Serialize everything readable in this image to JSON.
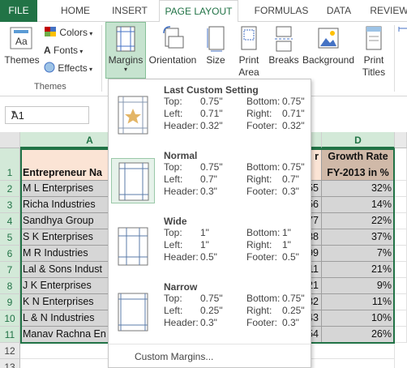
{
  "tabs": [
    {
      "label": "FILE"
    },
    {
      "label": "HOME"
    },
    {
      "label": "INSERT"
    },
    {
      "label": "PAGE LAYOUT"
    },
    {
      "label": "FORMULAS"
    },
    {
      "label": "DATA"
    },
    {
      "label": "REVIEW"
    }
  ],
  "ribbon": {
    "themes": "Themes",
    "colors": "Colors",
    "fonts": "Fonts",
    "effects": "Effects",
    "themes_group": "Themes",
    "margins": "Margins",
    "orientation": "Orientation",
    "size": "Size",
    "print_area_1": "Print",
    "print_area_2": "Area",
    "breaks": "Breaks",
    "background": "Background",
    "print_titles_1": "Print",
    "print_titles_2": "Titles"
  },
  "namebox": {
    "value": "A1"
  },
  "columns": [
    "A",
    "D"
  ],
  "rows": [
    "1",
    "2",
    "3",
    "4",
    "5",
    "6",
    "7",
    "8",
    "9",
    "10",
    "11",
    "12",
    "13"
  ],
  "header_a": "Entrepreneur Na",
  "header_c_fragment": "r",
  "header_d_1": "Growth Rate",
  "header_d_2": "FY-2013 in %",
  "data_rows": [
    {
      "name": "M L Enterprises",
      "c": "55",
      "d": "32%"
    },
    {
      "name": "Richa Industries",
      "c": "56",
      "d": "14%"
    },
    {
      "name": "Sandhya Group",
      "c": "77",
      "d": "22%"
    },
    {
      "name": "S K Enterprises",
      "c": "38",
      "d": "37%"
    },
    {
      "name": "M R Industries",
      "c": "99",
      "d": "7%"
    },
    {
      "name": "Lal & Sons Indust",
      "c": "11",
      "d": "21%"
    },
    {
      "name": "J K Enterprises",
      "c": "21",
      "d": "9%"
    },
    {
      "name": "K N Enterprises",
      "c": "32",
      "d": "11%"
    },
    {
      "name": "L & N Industries",
      "c": "43",
      "d": "10%"
    },
    {
      "name": "Manav Rachna En",
      "c": "54",
      "d": "26%"
    }
  ],
  "margins_menu": {
    "options": [
      {
        "title": "Last Custom Setting",
        "top": "0.75\"",
        "bottom": "0.75\"",
        "left": "0.71\"",
        "right": "0.71\"",
        "header": "0.32\"",
        "footer": "0.32\""
      },
      {
        "title": "Normal",
        "top": "0.75\"",
        "bottom": "0.75\"",
        "left": "0.7\"",
        "right": "0.7\"",
        "header": "0.3\"",
        "footer": "0.3\""
      },
      {
        "title": "Wide",
        "top": "1\"",
        "bottom": "1\"",
        "left": "1\"",
        "right": "1\"",
        "header": "0.5\"",
        "footer": "0.5\""
      },
      {
        "title": "Narrow",
        "top": "0.75\"",
        "bottom": "0.75\"",
        "left": "0.25\"",
        "right": "0.25\"",
        "header": "0.3\"",
        "footer": "0.3\""
      }
    ],
    "labels": {
      "top": "Top:",
      "bottom": "Bottom:",
      "left": "Left:",
      "right": "Right:",
      "header": "Header:",
      "footer": "Footer:"
    },
    "custom": "Custom Margins..."
  },
  "colors": {
    "excel_green": "#217346",
    "selection_gray": "#d6d6d6",
    "header_peach": "#fbe4d5",
    "header_brown": "#d0b9a8"
  }
}
